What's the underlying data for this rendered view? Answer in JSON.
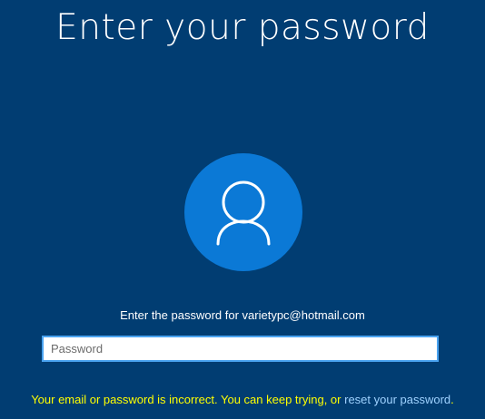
{
  "page": {
    "title": "Enter your password",
    "prompt": "Enter the password for varietypc@hotmail.com"
  },
  "avatar": {
    "icon": "user-icon",
    "background_color": "#0b79d6"
  },
  "password_input": {
    "value": "",
    "placeholder": "Password",
    "border_color": "#4aa3f0"
  },
  "error": {
    "text": "Your email or password is incorrect. You can keep trying, or ",
    "link_label": "reset your password",
    "trailing": ".",
    "text_color": "#ffff00",
    "link_color": "#9fd2ff"
  },
  "colors": {
    "background": "#013d72"
  }
}
